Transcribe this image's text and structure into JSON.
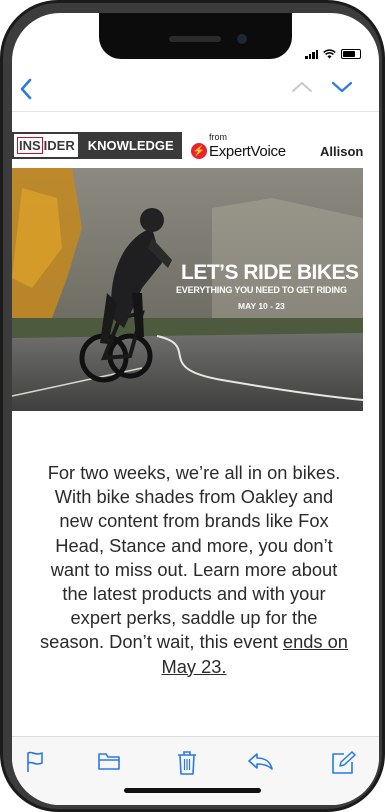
{
  "status_bar": {
    "icons": [
      "signal-icon",
      "wifi-icon",
      "battery-icon"
    ]
  },
  "nav": {
    "icons": [
      "back-chevron-icon",
      "up-chevron-icon",
      "down-chevron-icon"
    ]
  },
  "banner": {
    "brand_ins": "INS",
    "brand_ider": "IDER",
    "brand_knowledge": "KNOWLEDGE",
    "from_label": "from",
    "partner_name": "ExpertVoice",
    "user_name": "Allison"
  },
  "hero": {
    "title": "LET’S RIDE BIKES",
    "subtitle": "EVERYTHING YOU NEED TO GET RIDING",
    "dates": "MAY 10 - 23"
  },
  "body": {
    "text_main": "For two weeks, we’re all in on bikes. With bike shades from Oakley and new content from brands like Fox Head, Stance and more, you don’t want to miss out. Learn more about the latest products and with your expert perks, saddle up for the season. Don’t wait, this event ",
    "link_text": "ends on May 23."
  },
  "toolbar": {
    "icons": [
      "flag-icon",
      "folder-icon",
      "trash-icon",
      "reply-icon",
      "compose-icon"
    ]
  },
  "colors": {
    "accent": "#2a7ae2",
    "brand_red": "#c8102e",
    "dark": "#3a3a3a"
  }
}
